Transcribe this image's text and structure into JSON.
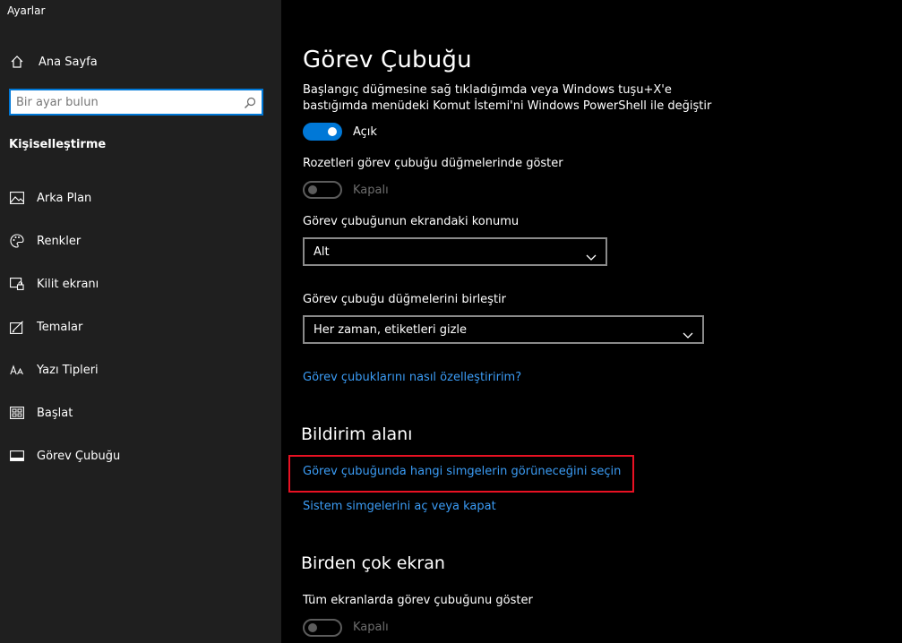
{
  "sidebar": {
    "app_title": "Ayarlar",
    "home_label": "Ana Sayfa",
    "search_placeholder": "Bir ayar bulun",
    "section_heading": "Kişiselleştirme",
    "items": [
      {
        "label": "Arka Plan",
        "icon": "picture-icon"
      },
      {
        "label": "Renkler",
        "icon": "palette-icon"
      },
      {
        "label": "Kilit ekranı",
        "icon": "lock-screen-icon"
      },
      {
        "label": "Temalar",
        "icon": "theme-icon"
      },
      {
        "label": "Yazı Tipleri",
        "icon": "font-icon"
      },
      {
        "label": "Başlat",
        "icon": "start-icon"
      },
      {
        "label": "Görev Çubuğu",
        "icon": "taskbar-icon"
      }
    ]
  },
  "main": {
    "title": "Görev Çubuğu",
    "powershell_desc": "Başlangıç düğmesine sağ tıkladığımda veya Windows tuşu+X'e bastığımda menüdeki Komut İstemi'ni Windows PowerShell ile değiştir",
    "powershell_toggle": "Açık",
    "badges_label": "Rozetleri görev çubuğu düğmelerinde göster",
    "badges_toggle": "Kapalı",
    "location_label": "Görev çubuğunun ekrandaki konumu",
    "location_value": "Alt",
    "combine_label": "Görev çubuğu düğmelerini birleştir",
    "combine_value": "Her zaman, etiketleri gizle",
    "customize_link": "Görev çubuklarını nasıl özelleştiririm?",
    "notification_heading": "Bildirim alanı",
    "select_icons_link": "Görev çubuğunda hangi simgelerin görüneceğini seçin",
    "system_icons_link": "Sistem simgelerini aç veya kapat",
    "multi_display_heading": "Birden çok ekran",
    "all_displays_label": "Tüm ekranlarda görev çubuğunu göster",
    "all_displays_toggle": "Kapalı"
  },
  "colors": {
    "accent": "#0078d7",
    "link": "#3b9cf5",
    "highlight": "#e81123",
    "sidebar_bg": "#1f1f1f",
    "main_bg": "#000000"
  }
}
